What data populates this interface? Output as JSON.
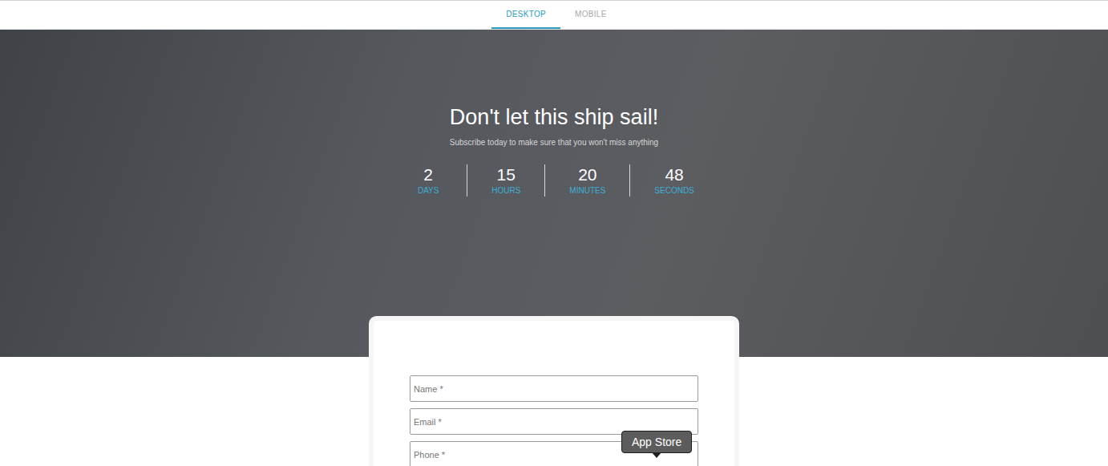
{
  "tabs": [
    {
      "label": "DESKTOP",
      "selected": true
    },
    {
      "label": "MOBILE",
      "selected": false
    }
  ],
  "hero": {
    "title": "Don't let this ship sail!",
    "subtitle": "Subscribe today to make sure that you won't miss anything"
  },
  "countdown": [
    {
      "value": "2",
      "unit": "DAYS"
    },
    {
      "value": "15",
      "unit": "HOURS"
    },
    {
      "value": "20",
      "unit": "MINUTES"
    },
    {
      "value": "48",
      "unit": "SECONDS"
    }
  ],
  "form": {
    "fields": [
      {
        "placeholder": "Name *"
      },
      {
        "placeholder": "Email *"
      },
      {
        "placeholder": "Phone *"
      }
    ]
  },
  "tooltip": {
    "text": "App Store"
  }
}
